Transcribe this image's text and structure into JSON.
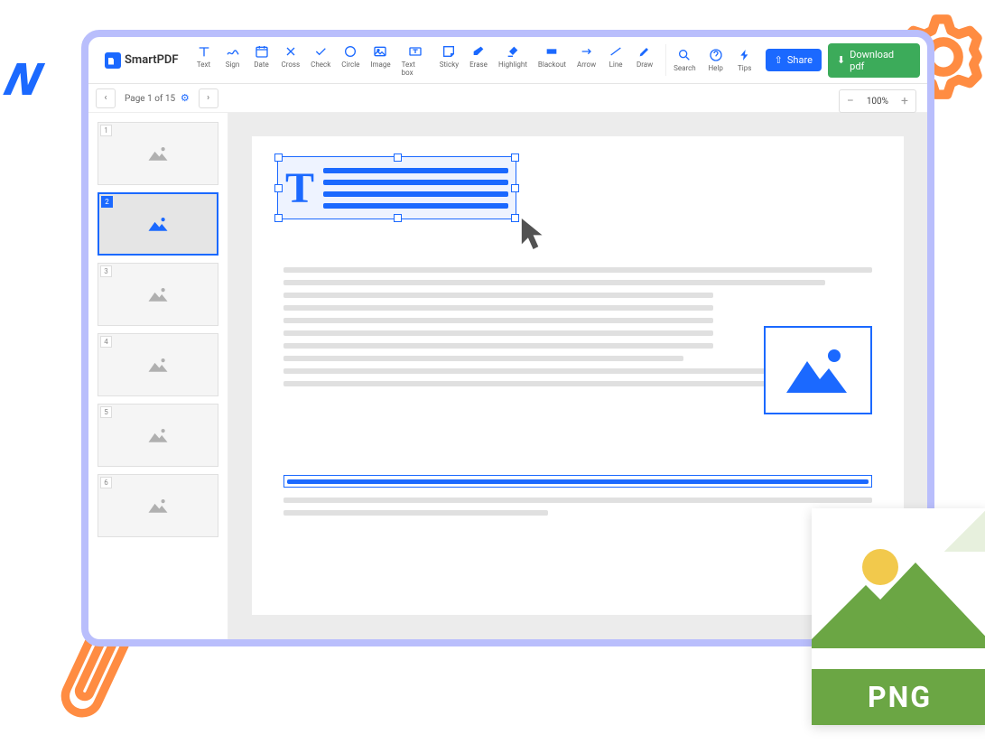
{
  "app": {
    "name": "SmartPDF"
  },
  "tools": [
    {
      "id": "text",
      "label": "Text"
    },
    {
      "id": "sign",
      "label": "Sign"
    },
    {
      "id": "date",
      "label": "Date"
    },
    {
      "id": "cross",
      "label": "Cross"
    },
    {
      "id": "check",
      "label": "Check"
    },
    {
      "id": "circle",
      "label": "Circle"
    },
    {
      "id": "image",
      "label": "Image"
    },
    {
      "id": "textbox",
      "label": "Text box"
    },
    {
      "id": "sticky",
      "label": "Sticky"
    },
    {
      "id": "erase",
      "label": "Erase"
    },
    {
      "id": "highlight",
      "label": "Highlight"
    },
    {
      "id": "blackout",
      "label": "Blackout"
    },
    {
      "id": "arrow",
      "label": "Arrow"
    },
    {
      "id": "line",
      "label": "Line"
    },
    {
      "id": "draw",
      "label": "Draw"
    }
  ],
  "aux": [
    {
      "id": "search",
      "label": "Search"
    },
    {
      "id": "help",
      "label": "Help"
    },
    {
      "id": "tips",
      "label": "Tips"
    }
  ],
  "buttons": {
    "share": "Share",
    "download": "Download pdf"
  },
  "pager": {
    "label": "Page 1 of 15"
  },
  "zoom": {
    "value": "100%"
  },
  "thumbs": [
    {
      "n": "1",
      "active": false
    },
    {
      "n": "2",
      "active": true
    },
    {
      "n": "3",
      "active": false
    },
    {
      "n": "4",
      "active": false
    },
    {
      "n": "5",
      "active": false
    },
    {
      "n": "6",
      "active": false
    }
  ],
  "png": {
    "label": "PNG"
  }
}
